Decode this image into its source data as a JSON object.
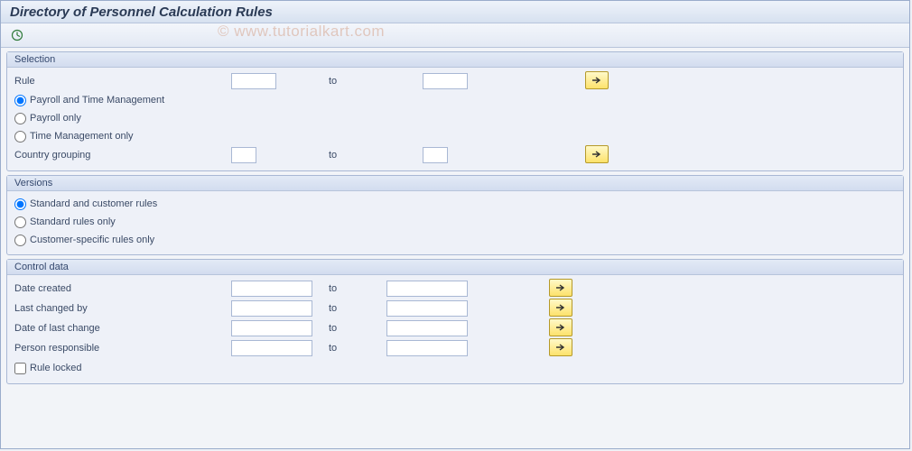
{
  "title": "Directory of Personnel Calculation Rules",
  "watermark": "© www.tutorialkart.com",
  "sections": {
    "selection": {
      "title": "Selection",
      "rule_label": "Rule",
      "to_label": "to",
      "radios": {
        "opt1": "Payroll and Time Management",
        "opt2": "Payroll only",
        "opt3": "Time Management only"
      },
      "country_label": "Country grouping"
    },
    "versions": {
      "title": "Versions",
      "radios": {
        "opt1": "Standard and customer rules",
        "opt2": "Standard rules only",
        "opt3": "Customer-specific rules only"
      }
    },
    "control": {
      "title": "Control data",
      "rows": {
        "date_created": "Date created",
        "last_changed_by": "Last changed by",
        "date_last_change": "Date of last change",
        "person_responsible": "Person responsible"
      },
      "to_label": "to",
      "rule_locked": "Rule locked"
    }
  }
}
